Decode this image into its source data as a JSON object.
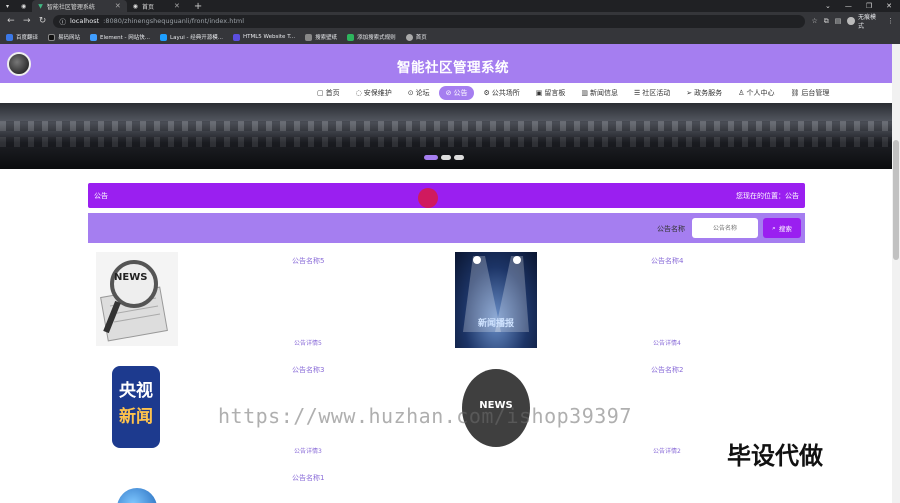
{
  "browser": {
    "tabs": [
      {
        "label": "智能社区管理系统",
        "active": true
      },
      {
        "label": "首页",
        "active": false
      }
    ],
    "url_host": "localhost",
    "url_rest": ":8080/zhinengshequguanli/front/index.html",
    "profile": "无痕模式",
    "bookmarks": [
      "百度翻译",
      "易码网站",
      "Element - 网站快...",
      "Layui - 经典开源模...",
      "HTML5 Website T...",
      "搜索壁纸",
      "添加搜索式规则",
      "首页"
    ]
  },
  "site": {
    "title": "智能社区管理系统",
    "menu": [
      {
        "icon": "home-icon",
        "label": "首页",
        "active": false
      },
      {
        "icon": "shield-icon",
        "label": "安保维护",
        "active": false
      },
      {
        "icon": "forum-icon",
        "label": "论坛",
        "active": false
      },
      {
        "icon": "link-icon",
        "label": "公告",
        "active": true
      },
      {
        "icon": "gear-icon",
        "label": "公共场所",
        "active": false
      },
      {
        "icon": "message-icon",
        "label": "留言板",
        "active": false
      },
      {
        "icon": "news-icon",
        "label": "新闻信息",
        "active": false
      },
      {
        "icon": "list-icon",
        "label": "社区活动",
        "active": false
      },
      {
        "icon": "send-icon",
        "label": "政务服务",
        "active": false
      },
      {
        "icon": "user-icon",
        "label": "个人中心",
        "active": false
      },
      {
        "icon": "link-icon",
        "label": "后台管理",
        "active": false
      }
    ]
  },
  "breadcrumb": {
    "title": "公告",
    "location": "您现在的位置：公告"
  },
  "search": {
    "label": "公告名称",
    "placeholder": "公告名称",
    "button": "搜索"
  },
  "cards": [
    {
      "title": "公告名称5",
      "detail": "公告详情5"
    },
    {
      "title": "公告名称4",
      "detail": "公告详情4"
    },
    {
      "title": "公告名称3",
      "detail": "公告详情3"
    },
    {
      "title": "公告名称2",
      "detail": "公告详情2"
    },
    {
      "title": "公告名称1",
      "detail": ""
    }
  ],
  "thumbs": {
    "news_badge": "NEWS",
    "stage_caption": "新闻播报",
    "cctv_lines": [
      "央视",
      "新闻"
    ],
    "circle_news": "NEWS"
  },
  "overlay": {
    "watermark": "https://www.huzhan.com/ishop39397",
    "tag": "毕设代做"
  },
  "colors": {
    "accent": "#a57ef0",
    "breadcrumb": "#9a1ff0"
  }
}
